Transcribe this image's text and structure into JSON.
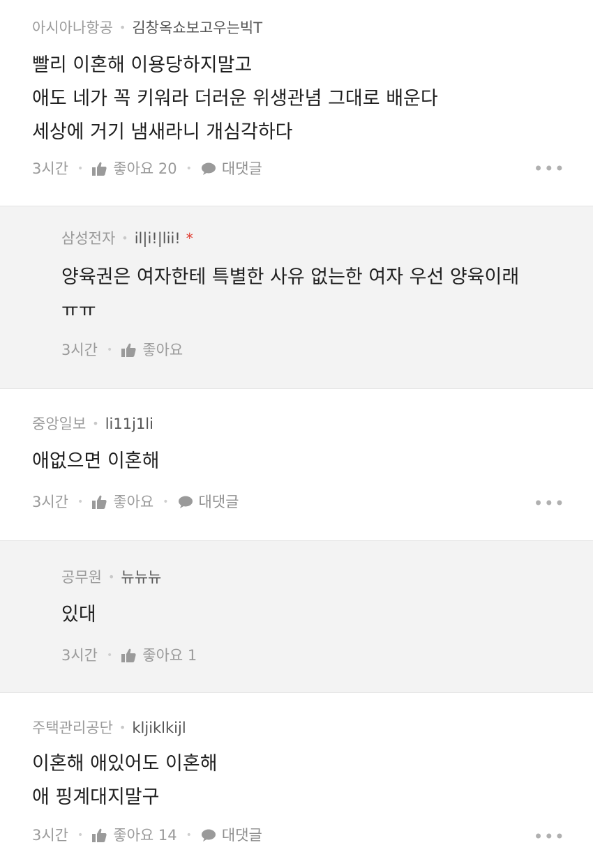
{
  "comments": [
    {
      "type": "top",
      "affiliation": "아시아나항공",
      "nickname": "김창옥쇼보고우는빅T",
      "lines": [
        "빨리 이혼해 이용당하지말고",
        "애도 네가 꼭 키워라 더러운 위생관념 그대로 배운다",
        "세상에 거기 냄새라니 개심각하다"
      ],
      "time": "3시간",
      "like_label": "좋아요 20",
      "reply_label": "대댓글"
    },
    {
      "type": "reply",
      "affiliation": "삼성전자",
      "nickname": "il|i!|lii!",
      "verified_mark": "*",
      "lines": [
        "양육권은 여자한테 특별한 사유 없는한 여자 우선 양육이래",
        "ㅠㅠ"
      ],
      "time": "3시간",
      "like_label": "좋아요"
    },
    {
      "type": "top",
      "affiliation": "중앙일보",
      "nickname": "li11j1li",
      "lines": [
        "애없으면 이혼해"
      ],
      "time": "3시간",
      "like_label": "좋아요",
      "reply_label": "대댓글"
    },
    {
      "type": "reply",
      "affiliation": "공무원",
      "nickname": "뉴뉴뉴",
      "lines": [
        "있대"
      ],
      "time": "3시간",
      "like_label": "좋아요 1"
    },
    {
      "type": "top",
      "affiliation": "주택관리공단",
      "nickname": "kljiklkijl",
      "lines": [
        "이혼해 애있어도 이혼해",
        "애 핑계대지말구"
      ],
      "time": "3시간",
      "like_label": "좋아요 14",
      "reply_label": "대댓글"
    }
  ],
  "more_label": "•••",
  "meta_separator": "•",
  "icons": {
    "like": "thumbs-up-icon",
    "reply": "speech-bubble-icon",
    "more": "more-options-icon"
  },
  "colors": {
    "reply_bg": "#f3f3f3",
    "verified_star": "#e0392e"
  }
}
